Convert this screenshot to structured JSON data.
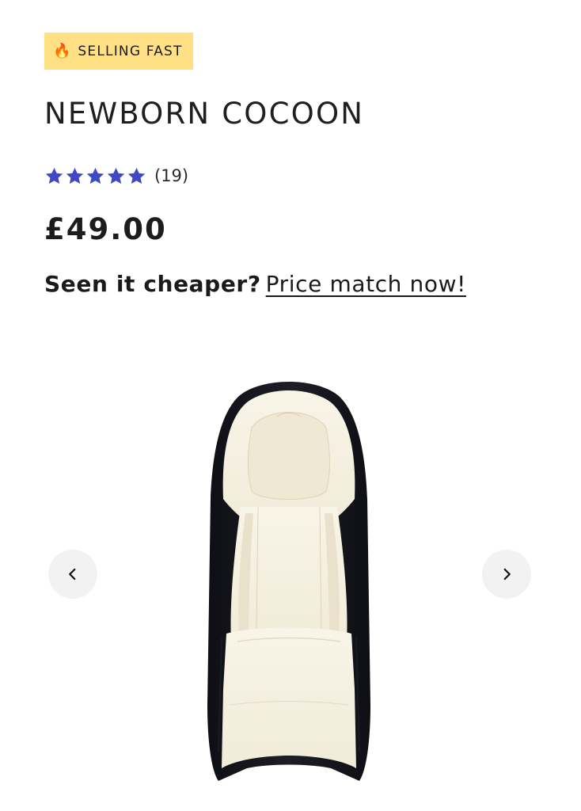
{
  "badge": {
    "icon": "fire-icon",
    "emoji": "🔥",
    "label": "SELLING FAST",
    "background": "#ffe084"
  },
  "product": {
    "title": "NEWBORN COCOON",
    "rating": {
      "stars": 5,
      "max_stars": 5,
      "count_label": "(19)",
      "star_color": "#3f48c6"
    },
    "price": "£49.00"
  },
  "price_match": {
    "question": "Seen it cheaper?",
    "link_label": "Price match now!"
  },
  "gallery": {
    "prev_icon": "chevron-left-icon",
    "next_icon": "chevron-right-icon",
    "image_colors": {
      "shell": "#15161c",
      "lining": "#f6f1e2"
    }
  }
}
